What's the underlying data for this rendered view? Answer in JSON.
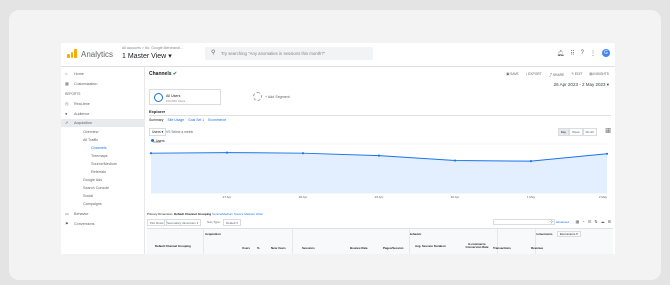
{
  "header": {
    "app_title": "Analytics",
    "breadcrumb": "All accounts > No. Google Merchandi...",
    "view_name": "1 Master View",
    "search_placeholder": "Try searching \"Any anomalies in sessions this month?\"",
    "avatar_letter": "G"
  },
  "sidebar": {
    "items": [
      {
        "icon": "home-icon",
        "glyph": "⌂",
        "label": "Home"
      },
      {
        "icon": "dashboard-icon",
        "glyph": "▦",
        "label": "Customization"
      },
      {
        "icon": "",
        "glyph": "",
        "label": "REPORTS"
      },
      {
        "icon": "clock-icon",
        "glyph": "◷",
        "label": "Real-time"
      },
      {
        "icon": "person-icon",
        "glyph": "●",
        "label": "Audience"
      },
      {
        "icon": "acquisition-icon",
        "glyph": "➚",
        "label": "Acquisition"
      },
      {
        "icon": "",
        "glyph": "",
        "label": "Overview"
      },
      {
        "icon": "",
        "glyph": "",
        "label": "All Traffic"
      },
      {
        "icon": "",
        "glyph": "",
        "label": "Channels"
      },
      {
        "icon": "",
        "glyph": "",
        "label": "Treemaps"
      },
      {
        "icon": "",
        "glyph": "",
        "label": "Source/Medium"
      },
      {
        "icon": "",
        "glyph": "",
        "label": "Referrals"
      },
      {
        "icon": "",
        "glyph": "",
        "label": "Google Ads"
      },
      {
        "icon": "",
        "glyph": "",
        "label": "Search Console"
      },
      {
        "icon": "",
        "glyph": "",
        "label": "Social"
      },
      {
        "icon": "",
        "glyph": "",
        "label": "Campaigns"
      },
      {
        "icon": "behavior-icon",
        "glyph": "▭",
        "label": "Behavior"
      },
      {
        "icon": "flag-icon",
        "glyph": "⚑",
        "label": "Conversions"
      }
    ]
  },
  "page": {
    "title": "Channels",
    "toolbar": [
      "SAVE",
      "EXPORT",
      "SHARE",
      "EDIT",
      "INSIGHTS"
    ],
    "date_range": "26 Apr 2023 - 2 May 2023",
    "segment_label": "All Users",
    "segment_sub": "100.00% Users",
    "add_segment": "+ Add Segment",
    "explorer": "Explorer",
    "subtabs": [
      "Summary",
      "Site Usage",
      "Goal Set 1",
      "Ecommerce"
    ],
    "metric": "Users",
    "vs": "VS Select a metric",
    "granularity": [
      "Day",
      "Week",
      "Month"
    ],
    "legend": "Users"
  },
  "chart_data": {
    "type": "area",
    "x": [
      "26 Apr",
      "27 Apr",
      "28 Apr",
      "29 Apr",
      "30 Apr",
      "1 May",
      "2 May"
    ],
    "x_tick_labels": [
      "27 Apr",
      "28 Apr",
      "29 Apr",
      "30 Apr",
      "1 May",
      "2 May"
    ],
    "y_tick_labels": [
      "4,000",
      "2,000"
    ],
    "series": [
      {
        "name": "Users",
        "values": [
          3250,
          3300,
          3250,
          3050,
          2650,
          2600,
          3200
        ]
      }
    ],
    "ylim": [
      0,
      4000
    ],
    "grid": true,
    "color": "#1a73e8"
  },
  "table": {
    "primary_label": "Primary Dimension:",
    "primary_options": [
      "Default Channel Grouping",
      "Source/Medium",
      "Source",
      "Medium",
      "Other"
    ],
    "plot_rows": "Plot Rows",
    "secondary": "Secondary dimension",
    "sort_type": "Sort Type:",
    "sort_value": "Default",
    "advanced": "advanced",
    "groups": [
      "Acquisition",
      "Behavior",
      "Conversions"
    ],
    "conversions_select": "Ecommerce",
    "columns": [
      "Default Channel Grouping",
      "Users",
      "%",
      "New Users",
      "Sessions",
      "Bounce Rate",
      "Pages/Session",
      "Avg. Session Duration",
      "E-commerce Conversion Rate",
      "Transactions",
      "Revenue"
    ]
  }
}
